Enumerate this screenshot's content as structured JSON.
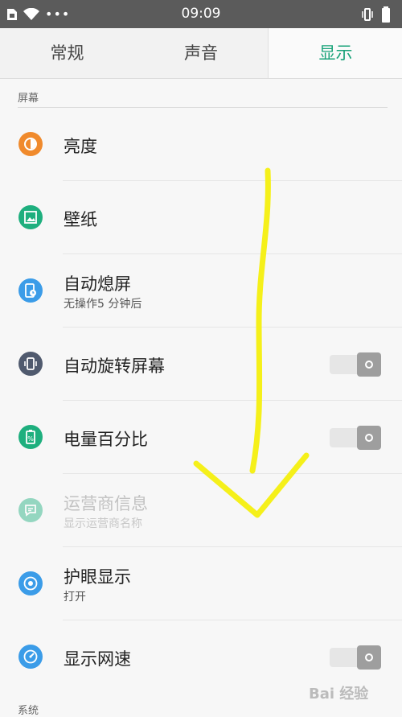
{
  "status_bar": {
    "time": "09:09",
    "more": "•••"
  },
  "tabs": [
    {
      "label": "常规"
    },
    {
      "label": "声音"
    },
    {
      "label": "显示",
      "selected": true
    }
  ],
  "sections": [
    {
      "title": "屏幕"
    },
    {
      "title": "系统"
    }
  ],
  "rows": [
    {
      "label": "亮度",
      "icon": "brightness-icon",
      "icon_color": "#f08a2c"
    },
    {
      "label": "壁纸",
      "icon": "wallpaper-icon",
      "icon_color": "#1eaf7e"
    },
    {
      "label": "自动熄屏",
      "sub": "无操作5 分钟后",
      "icon": "screen-timeout-icon",
      "icon_color": "#3b9ce8"
    },
    {
      "label": "自动旋转屏幕",
      "icon": "rotate-icon",
      "icon_color": "#505a6e",
      "toggle": "off"
    },
    {
      "label": "电量百分比",
      "icon": "battery-icon",
      "icon_color": "#1eaf7e",
      "toggle": "off"
    },
    {
      "label": "运营商信息",
      "sub": "显示运营商名称",
      "icon": "carrier-icon",
      "icon_color": "#1eaf7e",
      "disabled": true
    },
    {
      "label": "护眼显示",
      "sub": "打开",
      "icon": "eye-icon",
      "icon_color": "#3b9ce8"
    },
    {
      "label": "显示网速",
      "icon": "speed-icon",
      "icon_color": "#3b9ce8",
      "toggle": "off"
    }
  ],
  "watermark": "Bai 经验",
  "colors": {
    "accent": "#1aa37a",
    "annotation_arrow": "#f5f01a"
  }
}
